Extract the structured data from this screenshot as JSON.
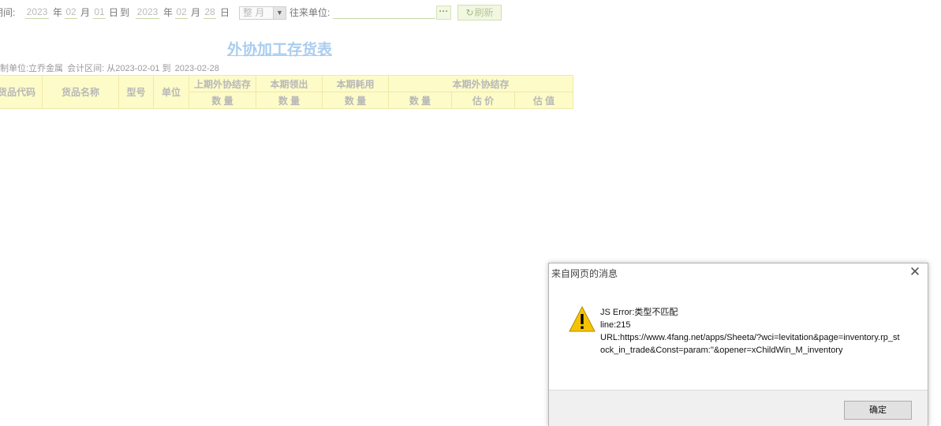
{
  "toolbar": {
    "period_label": "期间:",
    "start_year": "2023",
    "year_label_1": "年",
    "start_month": "02",
    "month_label_1": "月",
    "start_day": "01",
    "day_label_1": "日",
    "to_label": "到",
    "end_year": "2023",
    "year_label_2": "年",
    "end_month": "02",
    "month_label_2": "月",
    "end_day": "28",
    "day_label_2": "日",
    "period_select_value": "整 月",
    "partner_label": "往来单位:",
    "partner_value": "",
    "browse_button": "···",
    "refresh_button": "刷新"
  },
  "report": {
    "title": "外协加工存货表",
    "company_label": "制单位:立乔金属",
    "interval_label": "会计区间: 从2023-02-01 到",
    "interval_end": "2023-02-28"
  },
  "table": {
    "col_code": "货品代码",
    "col_name": "货品名称",
    "col_model": "型号",
    "col_unit": "单位",
    "grp_prev_balance": "上期外协结存",
    "grp_issued": "本期领出",
    "grp_consumed": "本期耗用",
    "grp_curr_balance": "本期外协结存",
    "sub_qty": "数 量",
    "sub_price": "估 价",
    "sub_value": "估 值"
  },
  "dialog": {
    "title": "来自网页的消息",
    "line1": "JS Error:类型不匹配",
    "line2": "line:215",
    "line3": "URL:https://www.4fang.net/apps/Sheeta/?wci=levitation&page=inventory.rp_stock_in_trade&Const=param:''&opener=xChildWin_M_inventory",
    "ok_button": "确定"
  },
  "colors": {
    "header_fill": "#fdfbc8",
    "title_link": "#a9cdf0",
    "warning_yellow": "#f5c400"
  }
}
